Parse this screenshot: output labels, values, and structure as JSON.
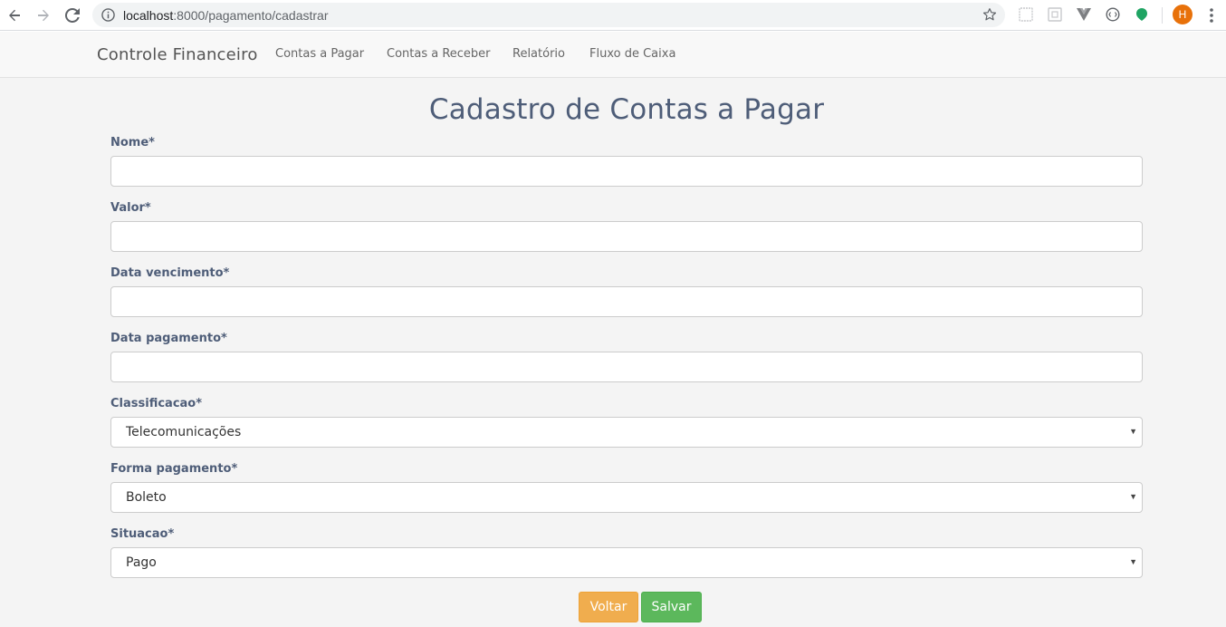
{
  "browser": {
    "url_host": "localhost",
    "url_port_path": ":8000/pagamento/cadastrar",
    "profile_initial": "H",
    "icons": [
      "back-icon",
      "forward-icon",
      "reload-icon",
      "info-icon",
      "bookmark-star-icon",
      "extension-icon",
      "menu-icon"
    ]
  },
  "navbar": {
    "brand": "Controle Financeiro",
    "links": [
      "Contas a Pagar",
      "Contas a Receber",
      "Relatório",
      "Fluxo de Caixa"
    ]
  },
  "form": {
    "title": "Cadastro de Contas a Pagar",
    "nome": {
      "label": "Nome*",
      "value": ""
    },
    "valor": {
      "label": "Valor*",
      "value": ""
    },
    "data_vencimento": {
      "label": "Data vencimento*",
      "value": ""
    },
    "data_pagamento": {
      "label": "Data pagamento*",
      "value": ""
    },
    "classificacao": {
      "label": "Classificacao*",
      "selected": "Telecomunicações"
    },
    "forma_pagamento": {
      "label": "Forma pagamento*",
      "selected": "Boleto"
    },
    "situacao": {
      "label": "Situacao*",
      "selected": "Pago"
    },
    "buttons": {
      "voltar": "Voltar",
      "salvar": "Salvar"
    }
  },
  "colors": {
    "title": "#4e5d78",
    "voltar": "#f0ad4e",
    "salvar": "#5cb85c",
    "avatar": "#e8710a"
  }
}
